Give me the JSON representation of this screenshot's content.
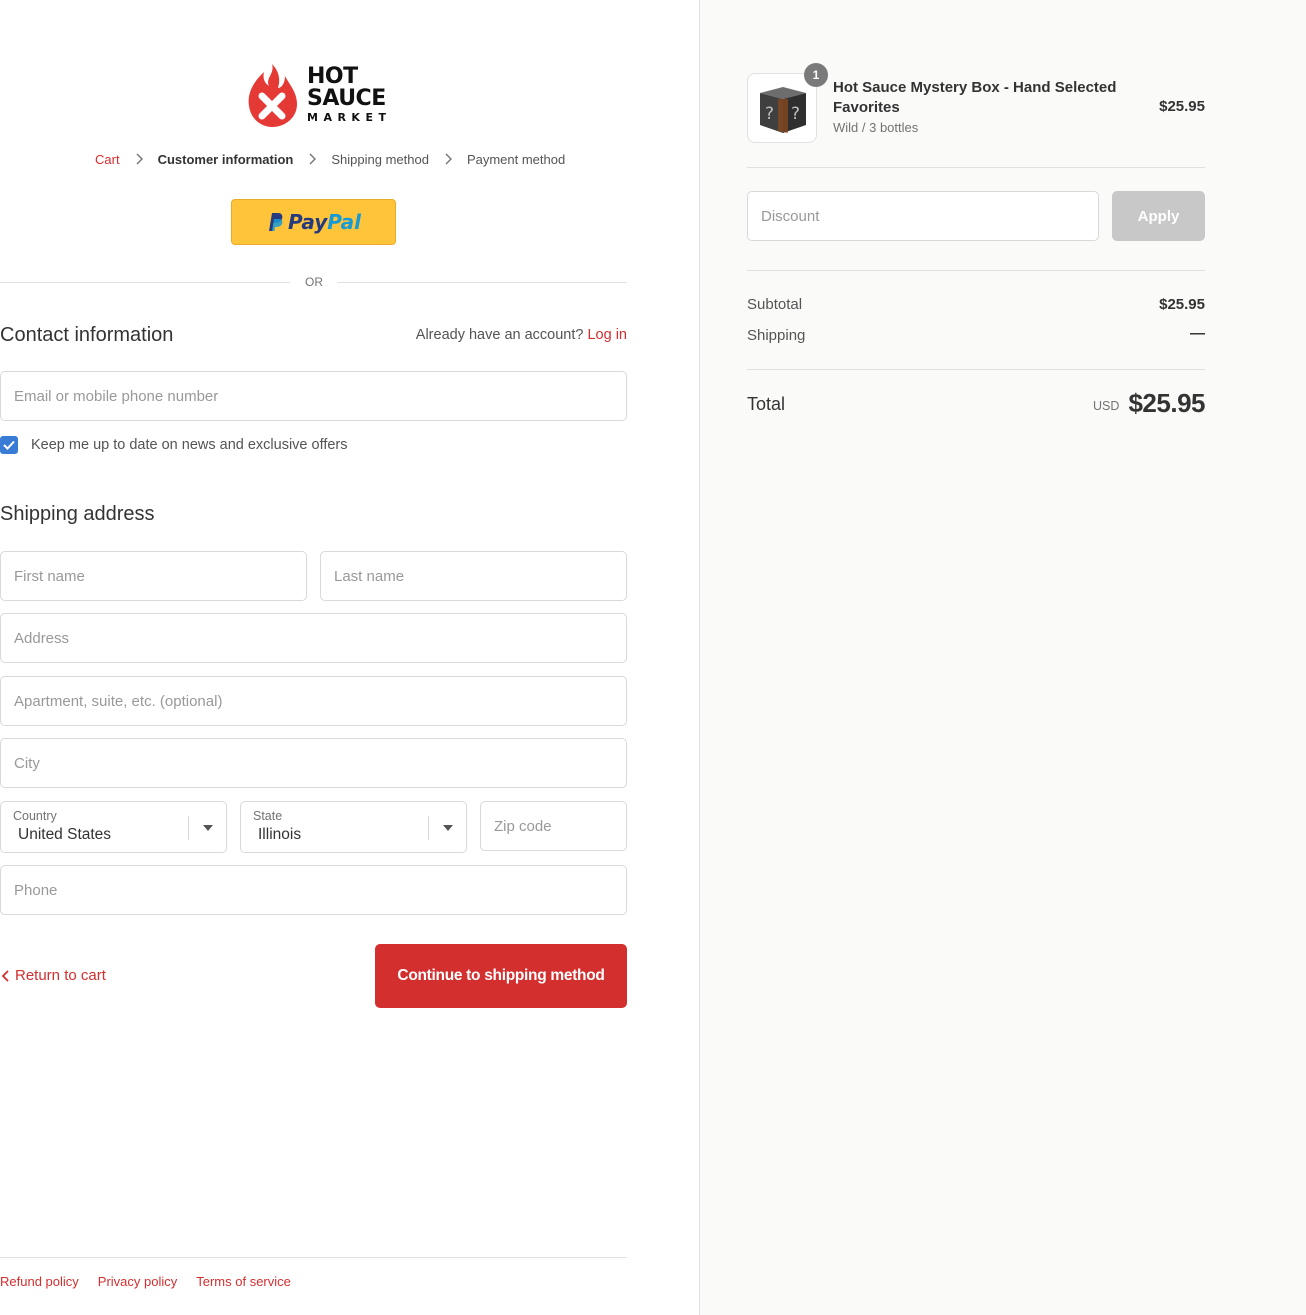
{
  "logo": {
    "line1": "HOT",
    "line2": "SAUCE",
    "line3": "MARKET",
    "icon": "flame-x-icon"
  },
  "breadcrumb": {
    "items": [
      "Cart",
      "Customer information",
      "Shipping method",
      "Payment method"
    ],
    "separator_icon": "chevron-right-icon"
  },
  "express": {
    "paypal_part1": "Pay",
    "paypal_part2": "Pal",
    "or_label": "OR"
  },
  "contact": {
    "title": "Contact information",
    "account_prompt": "Already have an account?",
    "login_label": "Log in",
    "email_placeholder": "Email or mobile phone number",
    "newsletter_label": "Keep me up to date on news and exclusive offers",
    "newsletter_checked": true
  },
  "shipping": {
    "title": "Shipping address",
    "first_name_placeholder": "First name",
    "last_name_placeholder": "Last name",
    "address_placeholder": "Address",
    "apartment_placeholder": "Apartment, suite, etc. (optional)",
    "city_placeholder": "City",
    "country_label": "Country",
    "country_value": "United States",
    "state_label": "State",
    "state_value": "Illinois",
    "zip_placeholder": "Zip code",
    "phone_placeholder": "Phone"
  },
  "actions": {
    "return_label": "Return to cart",
    "continue_label": "Continue to shipping method"
  },
  "footer": {
    "links": [
      "Refund policy",
      "Privacy policy",
      "Terms of service"
    ]
  },
  "summary": {
    "product": {
      "name": "Hot Sauce Mystery Box - Hand Selected Favorites",
      "variant": "Wild / 3 bottles",
      "price": "$25.95",
      "quantity": "1"
    },
    "discount_placeholder": "Discount",
    "apply_label": "Apply",
    "subtotal_label": "Subtotal",
    "subtotal_value": "$25.95",
    "shipping_label": "Shipping",
    "shipping_value": "—",
    "total_label": "Total",
    "currency": "USD",
    "total_value": "$25.95"
  },
  "colors": {
    "accent": "#d32f2f",
    "paypal_yellow": "#ffc439",
    "apply_disabled": "#c8c8c8",
    "checkbox": "#3a7bd5"
  }
}
